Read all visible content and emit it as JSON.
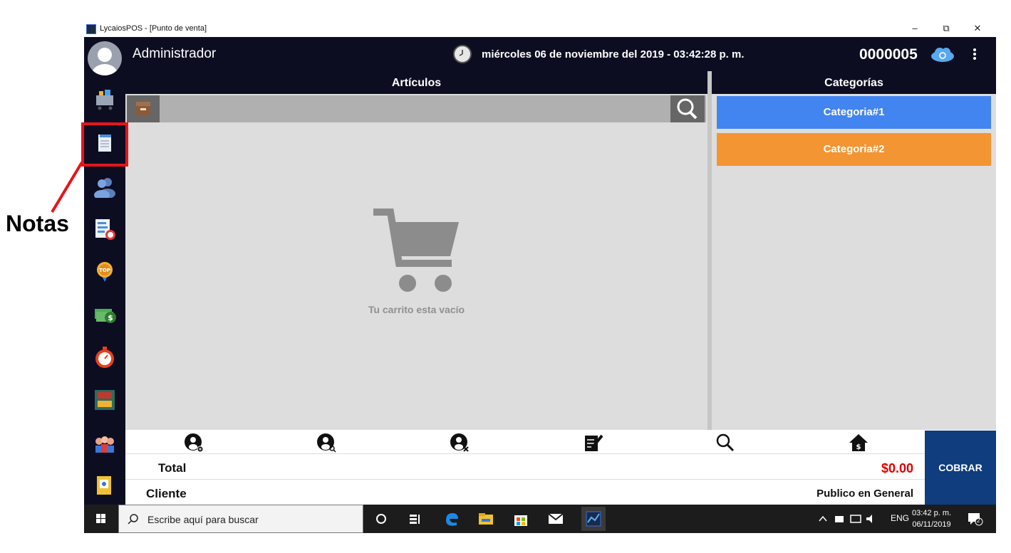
{
  "window": {
    "title": "LycaiosPOS - [Punto de venta]",
    "minimize_glyph": "–",
    "restore_glyph": "⧉",
    "close_glyph": "✕"
  },
  "header": {
    "user_name": "Administrador",
    "datetime": "miércoles 06 de noviembre del 2019 - 03:42:28 p. m.",
    "sale_number": "0000005"
  },
  "sidebar": {
    "items": [
      {
        "name": "sales-cart-icon"
      },
      {
        "name": "notes-icon"
      },
      {
        "name": "clients-icon"
      },
      {
        "name": "reports-icon"
      },
      {
        "name": "top-badge-icon"
      },
      {
        "name": "money-icon"
      },
      {
        "name": "timer-icon"
      },
      {
        "name": "inventory-icon"
      },
      {
        "name": "users-icon"
      },
      {
        "name": "settings-doc-icon"
      }
    ]
  },
  "annotation": {
    "label": "Notas",
    "color": "#e8141b"
  },
  "articles": {
    "title": "Artículos",
    "empty_text": "Tu carrito esta vacío"
  },
  "categories": {
    "title": "Categorías",
    "items": [
      {
        "label": "Categoria#1",
        "color": "#4285f0"
      },
      {
        "label": "Categoria#2",
        "color": "#f29532"
      }
    ]
  },
  "bottom": {
    "total_label": "Total",
    "total_value": "$0.00",
    "client_label": "Cliente",
    "client_value": "Publico en General",
    "cobrar_label": "COBRAR"
  },
  "taskbar": {
    "search_placeholder": "Escribe aquí para buscar",
    "lang": "ENG",
    "time": "03:42 p. m.",
    "date": "06/11/2019",
    "notification_count": "2"
  }
}
